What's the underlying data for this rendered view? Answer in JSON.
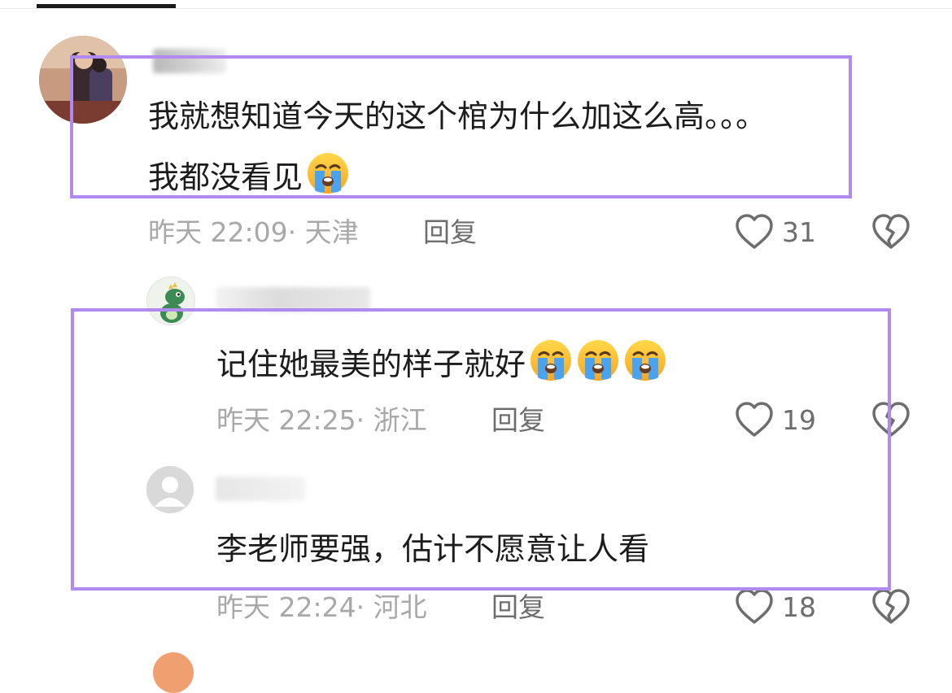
{
  "comments": [
    {
      "text_line1": "我就想知道今天的这个棺为什么加这么高。。。",
      "text_line2": "我都没看见",
      "time": "昨天 22:09",
      "location": "· 天津",
      "reply_label": "回复",
      "likes": "31"
    },
    {
      "text": "记住她最美的样子就好",
      "time": "昨天 22:25",
      "location": "· 浙江",
      "reply_label": "回复",
      "likes": "19"
    },
    {
      "text": "李老师要强，估计不愿意让人看",
      "time": "昨天 22:24",
      "location": "· 河北",
      "reply_label": "回复",
      "likes": "18"
    }
  ],
  "icons": {
    "emoji": "loudly-crying-face-emoji",
    "like": "heart-outline-icon",
    "dislike": "broken-heart-icon",
    "default_avatar": "default-user-avatar"
  },
  "colors": {
    "highlight_box": "#b08af0",
    "meta_text": "#a8a8a8",
    "reply_text": "#6d6d6d"
  }
}
